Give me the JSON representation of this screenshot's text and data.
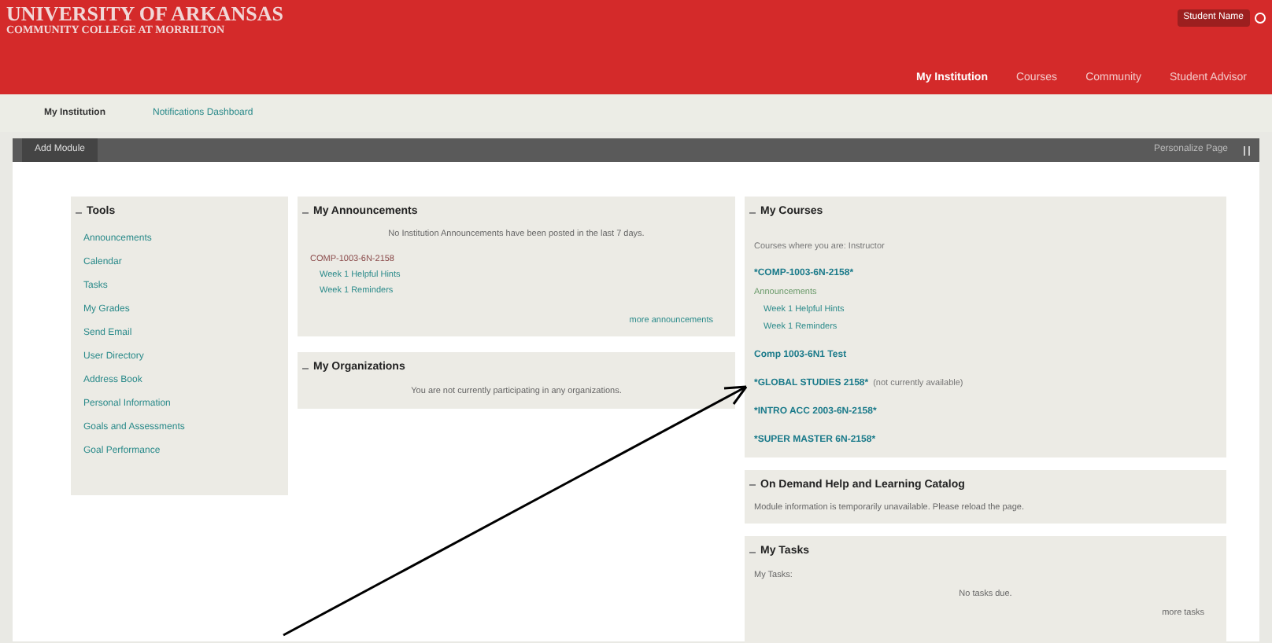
{
  "header": {
    "title": "UNIVERSITY OF ARKANSAS",
    "subtitle": "COMMUNITY COLLEGE AT MORRILTON",
    "user": "Student Name",
    "nav": [
      {
        "label": "My Institution",
        "selected": true
      },
      {
        "label": "Courses",
        "selected": false
      },
      {
        "label": "Community",
        "selected": false
      },
      {
        "label": "Student Advisor",
        "selected": false
      }
    ]
  },
  "subtabs": [
    {
      "label": "My Institution",
      "selected": true
    },
    {
      "label": "Notifications Dashboard",
      "selected": false
    }
  ],
  "toolbar": {
    "button": "Add Module",
    "right": "Personalize Page"
  },
  "tools": {
    "title": "Tools",
    "items": [
      "Announcements",
      "Calendar",
      "Tasks",
      "My Grades",
      "Send Email",
      "User Directory",
      "Address Book",
      "Personal Information",
      "Goals and Assessments",
      "Goal Performance"
    ]
  },
  "announcements": {
    "title": "My Announcements",
    "message": "No Institution Announcements have been posted in the last 7 days.",
    "course": "COMP-1003-6N-2158",
    "items": [
      "Week 1 Helpful Hints",
      "Week 1 Reminders"
    ],
    "more": "more announcements"
  },
  "organizations": {
    "title": "My Organizations",
    "message": "You are not currently participating in any organizations."
  },
  "courses": {
    "title": "My Courses",
    "intro": "Courses where you are: Instructor",
    "entries": [
      {
        "name": "*COMP-1003-6N-2158*",
        "label": "Announcements",
        "items": [
          "Week 1 Helpful Hints",
          "Week 1 Reminders"
        ]
      },
      {
        "name": "Comp 1003-6N1 Test"
      },
      {
        "name": "*GLOBAL STUDIES 2158*",
        "note": "(not currently available)"
      },
      {
        "name": "*INTRO ACC 2003-6N-2158*"
      },
      {
        "name": "*SUPER MASTER 6N-2158*"
      }
    ]
  },
  "help": {
    "title": "On Demand Help and Learning Catalog",
    "message": "Module information is temporarily unavailable. Please reload the page."
  },
  "tasks": {
    "title": "My Tasks",
    "label": "My Tasks:",
    "message": "No tasks due.",
    "more": "more tasks"
  }
}
